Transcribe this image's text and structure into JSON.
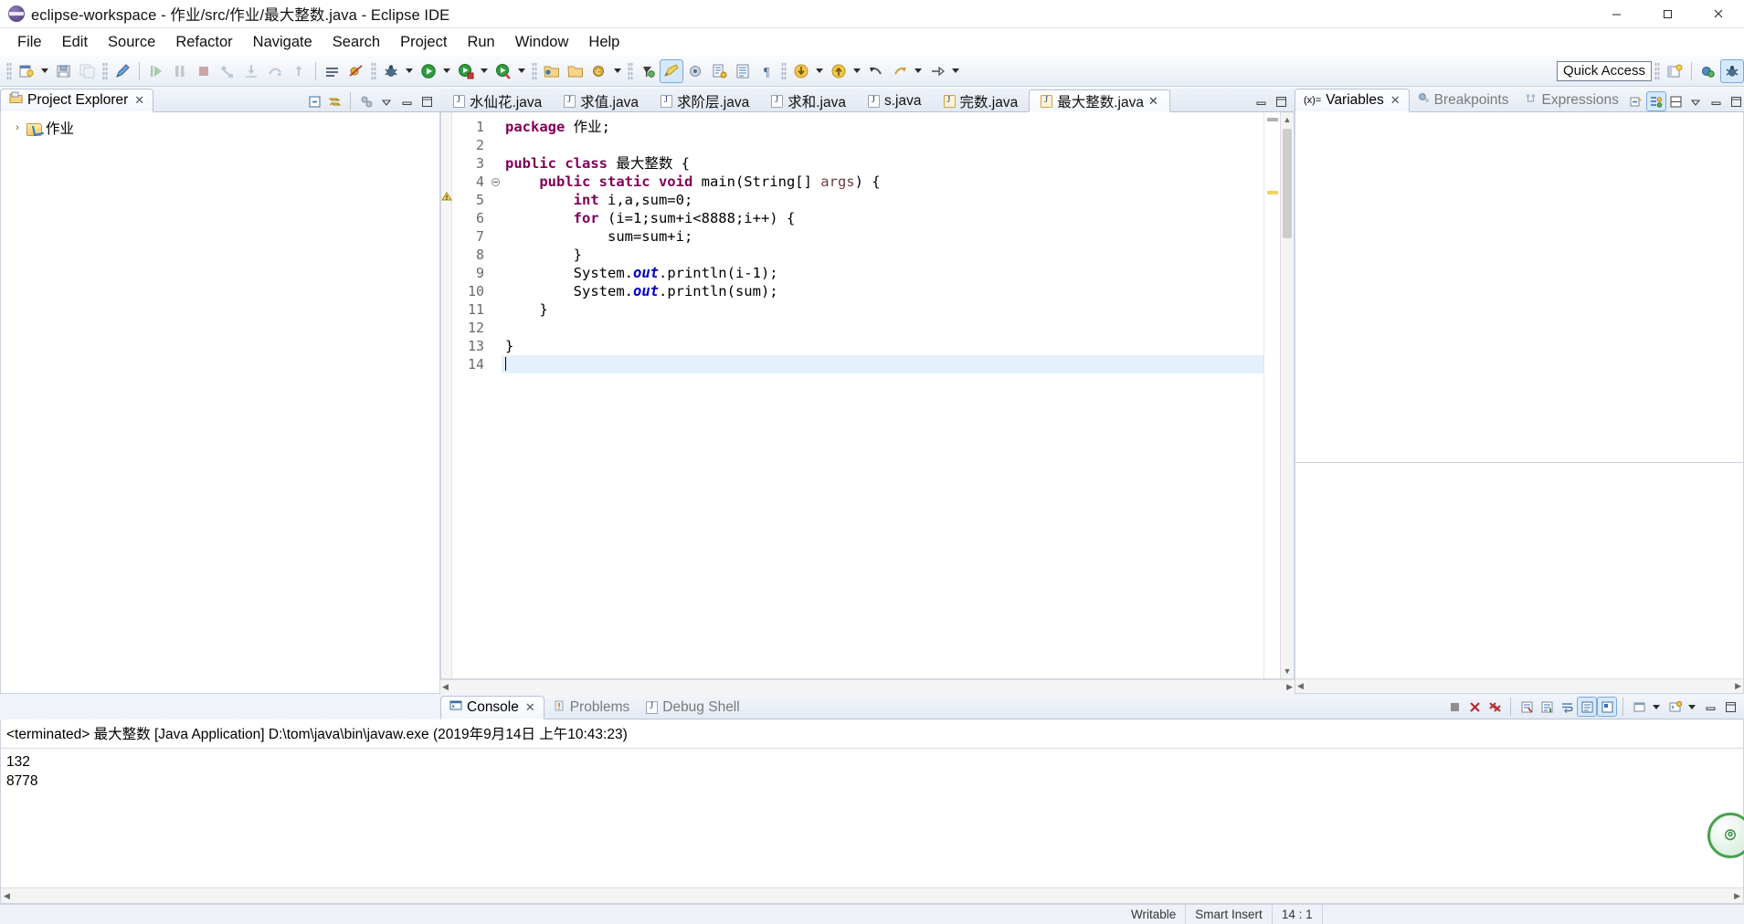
{
  "window": {
    "title": "eclipse-workspace - 作业/src/作业/最大整数.java - Eclipse IDE",
    "app_icon": "eclipse-icon",
    "minimize_label": "Minimize",
    "maximize_label": "Maximize",
    "close_label": "Close"
  },
  "menu": {
    "items": [
      {
        "label": "File"
      },
      {
        "label": "Edit"
      },
      {
        "label": "Source"
      },
      {
        "label": "Refactor"
      },
      {
        "label": "Navigate"
      },
      {
        "label": "Search"
      },
      {
        "label": "Project"
      },
      {
        "label": "Run"
      },
      {
        "label": "Window"
      },
      {
        "label": "Help"
      }
    ]
  },
  "toolbar": {
    "quick_access": "Quick Access",
    "buttons": [
      {
        "name": "new-wizard",
        "icon": "new-file-icon",
        "enabled": true,
        "dropdown": true
      },
      {
        "name": "save",
        "icon": "save-icon",
        "enabled": true
      },
      {
        "name": "save-all",
        "icon": "save-all-icon",
        "enabled": false
      },
      {
        "name": "link-editor",
        "icon": "pen-icon",
        "enabled": true
      },
      {
        "name": "resume",
        "icon": "resume-icon",
        "enabled": false
      },
      {
        "name": "suspend",
        "icon": "suspend-icon",
        "enabled": false
      },
      {
        "name": "terminate",
        "icon": "terminate-icon",
        "enabled": false
      },
      {
        "name": "disconnect",
        "icon": "disconnect-icon",
        "enabled": false
      },
      {
        "name": "step-into",
        "icon": "step-into-icon",
        "enabled": false
      },
      {
        "name": "step-over",
        "icon": "step-over-icon",
        "enabled": false
      },
      {
        "name": "step-return",
        "icon": "step-return-icon",
        "enabled": false
      },
      {
        "name": "toggle-breakpoint",
        "icon": "breakpoint-icon",
        "enabled": true
      },
      {
        "name": "skip-breakpoints",
        "icon": "skip-breakpoints-icon",
        "enabled": true
      },
      {
        "name": "debug",
        "icon": "debug-bug-icon",
        "enabled": true,
        "dropdown": true
      },
      {
        "name": "run",
        "icon": "run-green-icon",
        "enabled": true,
        "dropdown": true
      },
      {
        "name": "coverage",
        "icon": "coverage-icon",
        "enabled": true,
        "dropdown": true
      },
      {
        "name": "external-tools",
        "icon": "external-tools-icon",
        "enabled": true,
        "dropdown": true
      },
      {
        "name": "new-java-project",
        "icon": "java-project-icon",
        "enabled": true
      },
      {
        "name": "new-package",
        "icon": "package-icon",
        "enabled": true
      },
      {
        "name": "new-class",
        "icon": "class-icon",
        "enabled": true,
        "dropdown": true
      },
      {
        "name": "search-dialog",
        "icon": "search-icon",
        "enabled": true
      },
      {
        "name": "open-task",
        "icon": "task-yellow-icon",
        "enabled": true,
        "selected": true
      },
      {
        "name": "open-type",
        "icon": "open-type-icon",
        "enabled": true
      },
      {
        "name": "next-annotation",
        "icon": "next-annotation-icon",
        "enabled": true
      },
      {
        "name": "previous-annotation",
        "icon": "prev-annotation-icon",
        "enabled": true
      },
      {
        "name": "pilcrow",
        "icon": "pilcrow-icon",
        "enabled": true
      },
      {
        "name": "download-yellow",
        "icon": "download-arrow-icon",
        "enabled": true,
        "dropdown": true
      },
      {
        "name": "upload-yellow",
        "icon": "upload-arrow-icon",
        "enabled": true,
        "dropdown": true
      },
      {
        "name": "back",
        "icon": "back-arrow-icon",
        "enabled": true
      },
      {
        "name": "forward",
        "icon": "forward-arrow-icon",
        "enabled": true,
        "dropdown": true
      },
      {
        "name": "next-edit",
        "icon": "next-edit-icon",
        "enabled": true,
        "dropdown": true
      }
    ],
    "right_buttons": [
      {
        "name": "open-perspective",
        "icon": "open-perspective-icon"
      },
      {
        "name": "java-perspective",
        "icon": "java-perspective-icon"
      },
      {
        "name": "debug-perspective",
        "icon": "debug-perspective-icon",
        "selected": true
      }
    ]
  },
  "project_explorer": {
    "tab_label": "Project Explorer",
    "tab_icon": "project-explorer-icon",
    "close_glyph": "✕",
    "tools": [
      {
        "name": "collapse-all",
        "icon": "collapse-all-icon"
      },
      {
        "name": "link-with-editor",
        "icon": "link-editor-icon"
      },
      {
        "name": "view-menu-filters",
        "icon": "filters-icon"
      },
      {
        "name": "view-menu",
        "icon": "chevron-down-icon"
      },
      {
        "name": "minimize-view",
        "icon": "minimize-icon"
      },
      {
        "name": "maximize-view",
        "icon": "maximize-icon"
      }
    ],
    "tree": [
      {
        "label": "作业",
        "icon": "java-project-icon",
        "expanded": false,
        "twisty": "›"
      }
    ]
  },
  "editor": {
    "tabs": [
      {
        "label": "水仙花.java",
        "icon": "java-file-icon",
        "active": false,
        "warn": false
      },
      {
        "label": "求值.java",
        "icon": "java-file-icon",
        "active": false,
        "warn": false
      },
      {
        "label": "求阶层.java",
        "icon": "java-file-icon",
        "active": false,
        "warn": false
      },
      {
        "label": "求和.java",
        "icon": "java-file-icon",
        "active": false,
        "warn": false
      },
      {
        "label": "s.java",
        "icon": "java-file-icon",
        "active": false,
        "warn": false
      },
      {
        "label": "完数.java",
        "icon": "java-file-warning-icon",
        "active": false,
        "warn": true
      },
      {
        "label": "最大整数.java",
        "icon": "java-file-warning-icon",
        "active": true,
        "warn": true,
        "close_glyph": "✕"
      }
    ],
    "view_tools": [
      {
        "name": "minimize-editor",
        "icon": "minimize-icon"
      },
      {
        "name": "maximize-editor",
        "icon": "maximize-icon"
      }
    ],
    "lines": [
      {
        "n": 1,
        "segments": [
          {
            "t": "package ",
            "c": "kw"
          },
          {
            "t": "作业;",
            "c": "plain"
          }
        ]
      },
      {
        "n": 2,
        "segments": [
          {
            "t": "",
            "c": "plain"
          }
        ]
      },
      {
        "n": 3,
        "segments": [
          {
            "t": "public class ",
            "c": "kw"
          },
          {
            "t": "最大整数 {",
            "c": "plain"
          }
        ]
      },
      {
        "n": 4,
        "fold": true,
        "segments": [
          {
            "t": "    ",
            "c": "plain"
          },
          {
            "t": "public static void ",
            "c": "kw"
          },
          {
            "t": "main(String[] ",
            "c": "plain"
          },
          {
            "t": "args",
            "c": "param"
          },
          {
            "t": ") {",
            "c": "plain"
          }
        ]
      },
      {
        "n": 5,
        "warn": true,
        "segments": [
          {
            "t": "        ",
            "c": "plain"
          },
          {
            "t": "int ",
            "c": "kw"
          },
          {
            "t": "i,a,sum=0;",
            "c": "plain"
          }
        ]
      },
      {
        "n": 6,
        "segments": [
          {
            "t": "        ",
            "c": "plain"
          },
          {
            "t": "for ",
            "c": "kw"
          },
          {
            "t": "(i=1;sum+i<8888;i++) {",
            "c": "plain"
          }
        ]
      },
      {
        "n": 7,
        "segments": [
          {
            "t": "            sum=sum+i;",
            "c": "plain"
          }
        ]
      },
      {
        "n": 8,
        "segments": [
          {
            "t": "        }",
            "c": "plain"
          }
        ]
      },
      {
        "n": 9,
        "segments": [
          {
            "t": "        System.",
            "c": "plain"
          },
          {
            "t": "out",
            "c": "field"
          },
          {
            "t": ".println(i-1);",
            "c": "plain"
          }
        ]
      },
      {
        "n": 10,
        "segments": [
          {
            "t": "        System.",
            "c": "plain"
          },
          {
            "t": "out",
            "c": "field"
          },
          {
            "t": ".println(sum);",
            "c": "plain"
          }
        ]
      },
      {
        "n": 11,
        "segments": [
          {
            "t": "    }",
            "c": "plain"
          }
        ]
      },
      {
        "n": 12,
        "segments": [
          {
            "t": "",
            "c": "plain"
          }
        ]
      },
      {
        "n": 13,
        "segments": [
          {
            "t": "}",
            "c": "plain"
          }
        ]
      },
      {
        "n": 14,
        "current": true,
        "caret": true,
        "segments": [
          {
            "t": "",
            "c": "plain"
          }
        ]
      }
    ]
  },
  "debug_panel": {
    "tabs": [
      {
        "label": "Variables",
        "icon": "variables-icon",
        "active": true,
        "close_glyph": "✕"
      },
      {
        "label": "Breakpoints",
        "icon": "breakpoints-icon",
        "active": false
      },
      {
        "label": "Expressions",
        "icon": "expressions-icon",
        "active": false
      }
    ],
    "tools": [
      {
        "name": "collapse-all-variables",
        "icon": "collapse-all-icon"
      },
      {
        "name": "show-logical-structure",
        "icon": "logical-structure-icon",
        "selected": true
      },
      {
        "name": "show-detail-pane",
        "icon": "detail-pane-icon"
      },
      {
        "name": "view-menu",
        "icon": "chevron-down-icon"
      },
      {
        "name": "minimize-view",
        "icon": "minimize-icon"
      },
      {
        "name": "maximize-view",
        "icon": "maximize-icon"
      }
    ]
  },
  "console": {
    "tabs": [
      {
        "label": "Console",
        "icon": "console-icon",
        "active": true,
        "close_glyph": "✕"
      },
      {
        "label": "Problems",
        "icon": "problems-icon",
        "active": false
      },
      {
        "label": "Debug Shell",
        "icon": "debug-shell-icon",
        "active": false
      }
    ],
    "tools": [
      {
        "name": "terminate",
        "icon": "terminate-red-icon"
      },
      {
        "name": "remove-launch",
        "icon": "remove-icon"
      },
      {
        "name": "remove-all-terminated",
        "icon": "remove-all-icon"
      },
      {
        "name": "clear-console",
        "icon": "clear-console-icon"
      },
      {
        "name": "scroll-lock",
        "icon": "scroll-lock-icon"
      },
      {
        "name": "word-wrap",
        "icon": "word-wrap-icon"
      },
      {
        "name": "show-console-on-output",
        "icon": "show-on-output-icon",
        "selected": true
      },
      {
        "name": "pin-console",
        "icon": "pin-icon",
        "selected": true
      },
      {
        "name": "display-selected-console",
        "icon": "display-console-icon",
        "dropdown": true
      },
      {
        "name": "open-console",
        "icon": "open-console-icon",
        "dropdown": true
      },
      {
        "name": "minimize-view",
        "icon": "minimize-icon"
      },
      {
        "name": "maximize-view",
        "icon": "maximize-icon"
      }
    ],
    "header": "<terminated> 最大整数 [Java Application] D:\\tom\\java\\bin\\javaw.exe (2019年9月14日 上午10:43:23)",
    "output_lines": [
      "132",
      "8778"
    ]
  },
  "status_bar": {
    "cells": [
      "Writable",
      "Smart Insert",
      "14 : 1"
    ]
  },
  "colors": {
    "keyword": "#7f0055",
    "field": "#0000c0",
    "param": "#6a3e3e",
    "selection": "#e4f0fb",
    "accent": "#3a6ea5"
  }
}
